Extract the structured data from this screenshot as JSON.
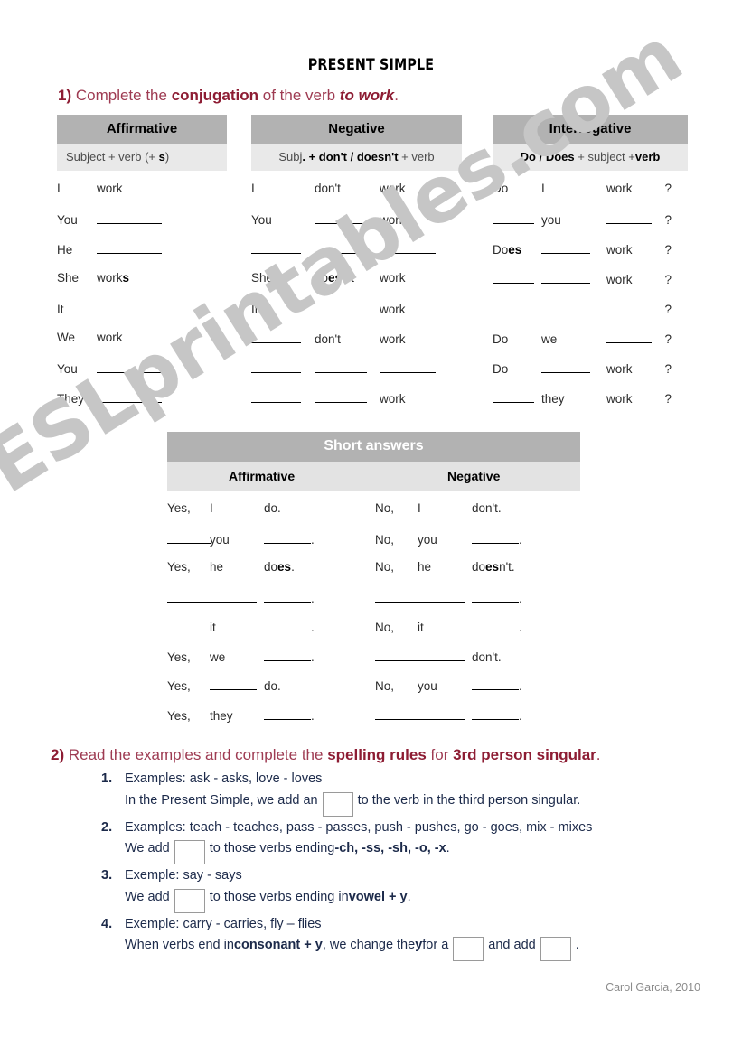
{
  "page": {
    "title": "PRESENT SIMPLE",
    "footer": "Carol Garcia, 2010",
    "watermark": "ESLprintables.com",
    "accent_red": "#8d1c33",
    "body_navy": "#1c2a4a",
    "header_gray": "#b2b2b2",
    "subheader_gray": "#e9e9e9"
  },
  "exercise1": {
    "number": "1)",
    "text_a": " Complete the ",
    "bold_a": "conjugation",
    "text_b": " of the verb ",
    "italic_a": "to work",
    "text_c": "."
  },
  "exercise2": {
    "number": "2)",
    "text_a": " Read the examples and complete the ",
    "bold_a": "spelling rules",
    "text_b": " for ",
    "bold_b": "3rd person singular",
    "text_c": "."
  },
  "conjugation": {
    "affirmative": {
      "header": "Affirmative",
      "formula_plain_a": "Subject + verb (+ ",
      "formula_bold": "s",
      "formula_plain_b": ")",
      "rows": [
        {
          "c1": "I",
          "c2": "work"
        },
        {
          "c1": "You",
          "c2": ""
        },
        {
          "c1": "He",
          "c2": ""
        },
        {
          "c1": "She",
          "c2": "work",
          "c2_bold": "s"
        },
        {
          "c1": "It",
          "c2": ""
        },
        {
          "c1": "We",
          "c2": "work"
        },
        {
          "c1": "You",
          "c2": ""
        },
        {
          "c1": "They",
          "c2": ""
        }
      ]
    },
    "negative": {
      "header": "Negative",
      "formula_plain_a": "Subj",
      "formula_bold_a": ". + don't / doesn't",
      "formula_plain_b": " + verb",
      "rows": [
        {
          "c1": "I",
          "c2": "don't",
          "c3": "work"
        },
        {
          "c1": "You",
          "c2": "",
          "c3": "work"
        },
        {
          "c1": "",
          "c2": "",
          "c3": ""
        },
        {
          "c1": "She",
          "c2": "doesn't",
          "c2_bold_range": "es",
          "c3": "work"
        },
        {
          "c1": "It",
          "c2": "",
          "c3": "work"
        },
        {
          "c1": "",
          "c2": "don't",
          "c3": "work"
        },
        {
          "c1": "",
          "c2": "",
          "c3": ""
        },
        {
          "c1": "",
          "c2": "",
          "c3": "work"
        }
      ]
    },
    "interrogative": {
      "header": "Interrogative",
      "formula_bold_a": "Do / Does",
      "formula_plain_a": " + subject +",
      "formula_bold_b": "verb",
      "rows": [
        {
          "c1": "Do",
          "c2": "I",
          "c3": "work",
          "c4": "?"
        },
        {
          "c1": "",
          "c2": "you",
          "c3": "",
          "c4": "?"
        },
        {
          "c1": "Does",
          "c1_bold_range": "es",
          "c2": "",
          "c3": "work",
          "c4": "?"
        },
        {
          "c1": "",
          "c2": "",
          "c3": "work",
          "c4": "?"
        },
        {
          "c1": "",
          "c2": "",
          "c3": "",
          "c4": "?"
        },
        {
          "c1": "Do",
          "c2": "we",
          "c3": "",
          "c4": "?"
        },
        {
          "c1": "Do",
          "c2": "",
          "c3": "work",
          "c4": "?"
        },
        {
          "c1": "",
          "c2": "they",
          "c3": "work",
          "c4": "?"
        }
      ]
    }
  },
  "short_answers": {
    "header": "Short answers",
    "col_affirmative": "Affirmative",
    "col_negative": "Negative",
    "rows": [
      {
        "a1": "Yes,",
        "a2": "I",
        "a3": "do.",
        "n1": "No,",
        "n2": "I",
        "n3": "don't."
      },
      {
        "a1": "",
        "a2": "you",
        "a3": "",
        "n1": "No,",
        "n2": "you",
        "n3": ""
      },
      {
        "a1": "Yes,",
        "a2": "he",
        "a3": "does.",
        "a3_bold_range": "es",
        "n1": "No,",
        "n2": "he",
        "n3": "doesn't.",
        "n3_bold_range": "es"
      },
      {
        "a1": "",
        "a2": "",
        "a3": "",
        "n1": "",
        "n2": "",
        "n3": ""
      },
      {
        "a1": "",
        "a2": "it",
        "a3": "",
        "n1": "No,",
        "n2": "it",
        "n3": ""
      },
      {
        "a1": "Yes,",
        "a2": "we",
        "a3": "",
        "n1": "",
        "n2": "",
        "n3": "don't."
      },
      {
        "a1": "Yes,",
        "a2": "",
        "a3": "do.",
        "n1": "No,",
        "n2": "you",
        "n3": ""
      },
      {
        "a1": "Yes,",
        "a2": "they",
        "a3": "",
        "n1": "",
        "n2": "",
        "n3": ""
      }
    ]
  },
  "spelling_rules": [
    {
      "num": "1.",
      "line1_a": "Examples: ask - asks, love - loves",
      "line2_a": "In the Present Simple, we add an",
      "line2_b": "to the verb in the third person singular."
    },
    {
      "num": "2.",
      "line1_a": "Examples: teach - teaches, pass - passes, push - pushes, go - goes, mix - mixes",
      "line2_a": "We add",
      "line2_b": "to those verbs ending ",
      "line2_bold": "-ch, -ss, -sh, -o, -x",
      "line2_c": "."
    },
    {
      "num": "3.",
      "line1_a": "Exemple: say - says",
      "line2_a": "We add",
      "line2_b": "to those verbs ending in ",
      "line2_bold": "vowel + y",
      "line2_c": "."
    },
    {
      "num": "4.",
      "line1_a": "Exemple: carry - carries, fly – flies",
      "line2_a": "When verbs end in ",
      "line2_bold": "consonant + y",
      "line2_b": ", we change the ",
      "line2_bold2": "y",
      "line2_c": " for a",
      "line2_d": "and add",
      "line2_e": "."
    }
  ]
}
